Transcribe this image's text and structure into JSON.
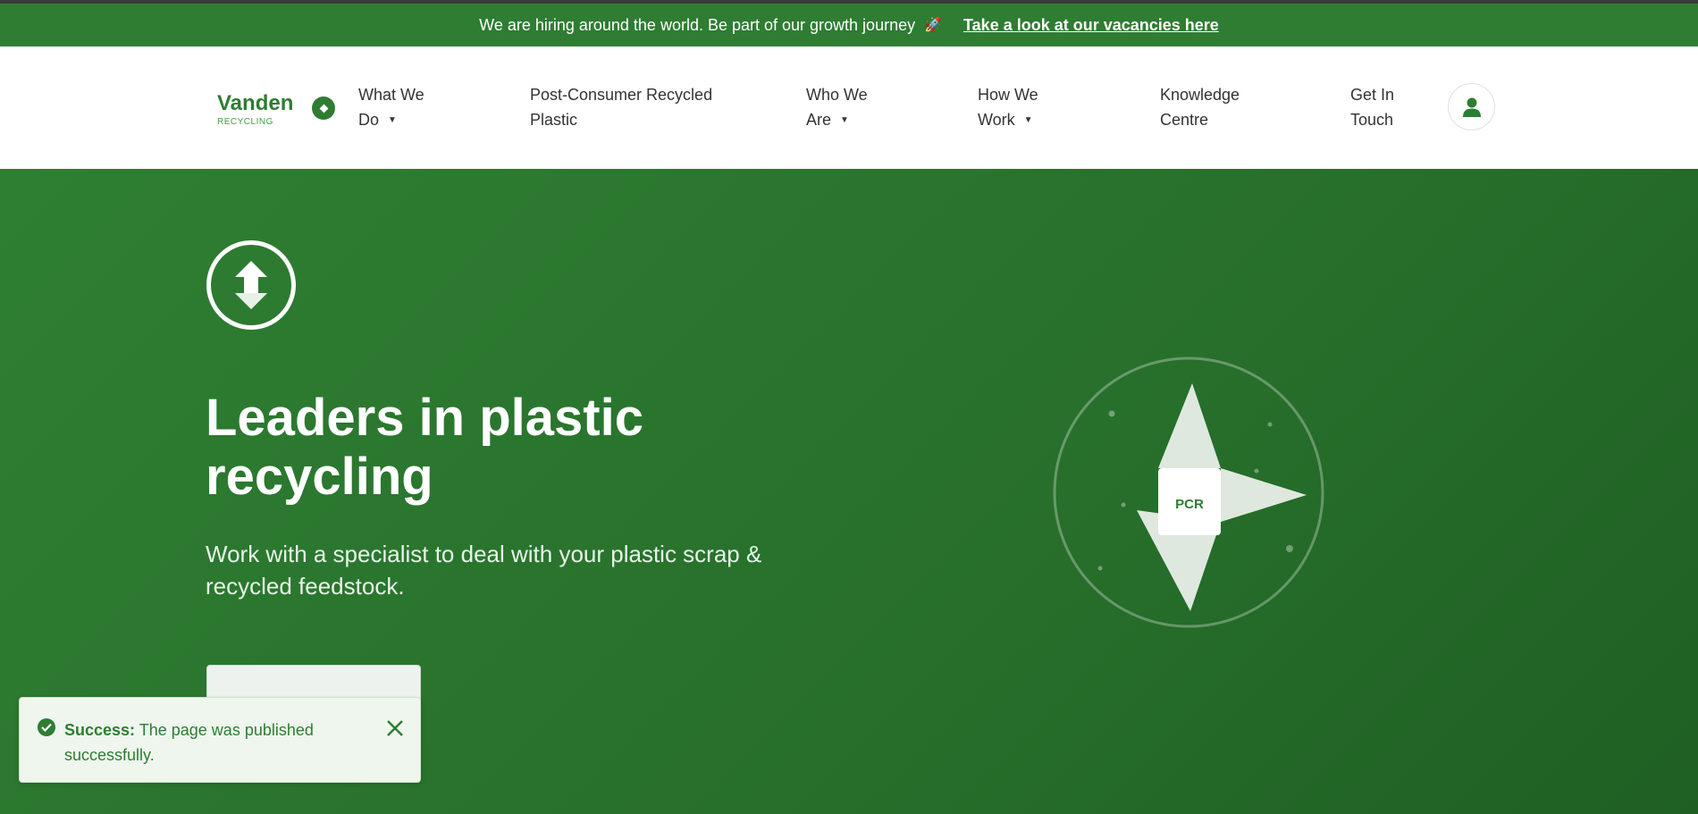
{
  "announcement": {
    "message": "We are hiring around the world. Be part of our growth journey",
    "rocket": "🚀",
    "link": "Take a look at our vacancies here"
  },
  "header": {
    "logo": {
      "brand": "Vanden",
      "sub": "RECYCLING"
    },
    "nav": [
      {
        "line1": "What We",
        "line2": "Do",
        "has_dropdown": true
      },
      {
        "line1": "Post-Consumer Recycled",
        "line2": "Plastic",
        "has_dropdown": false
      },
      {
        "line1": "Who We",
        "line2": "Are",
        "has_dropdown": true
      },
      {
        "line1": "How We",
        "line2": "Work",
        "has_dropdown": true
      },
      {
        "line1": "Knowledge",
        "line2": "Centre",
        "has_dropdown": false
      },
      {
        "line1": "Get In",
        "line2": "Touch",
        "has_dropdown": false
      }
    ],
    "account_icon": "user-icon"
  },
  "hero": {
    "icon": "up-down-arrows-icon",
    "title": "Leaders in plastic recycling",
    "subtitle": "Work with a specialist to deal with your plastic scrap & recycled feedstock.",
    "graphic_label": "PCR"
  },
  "toast": {
    "label": "Success:",
    "message": "The page was published successfully.",
    "icon": "check-circle-icon",
    "close_icon": "close-icon"
  },
  "colors": {
    "primary": "#2e7d32",
    "hero_bg": "#2b7830",
    "toast_bg": "#eef6ee"
  }
}
